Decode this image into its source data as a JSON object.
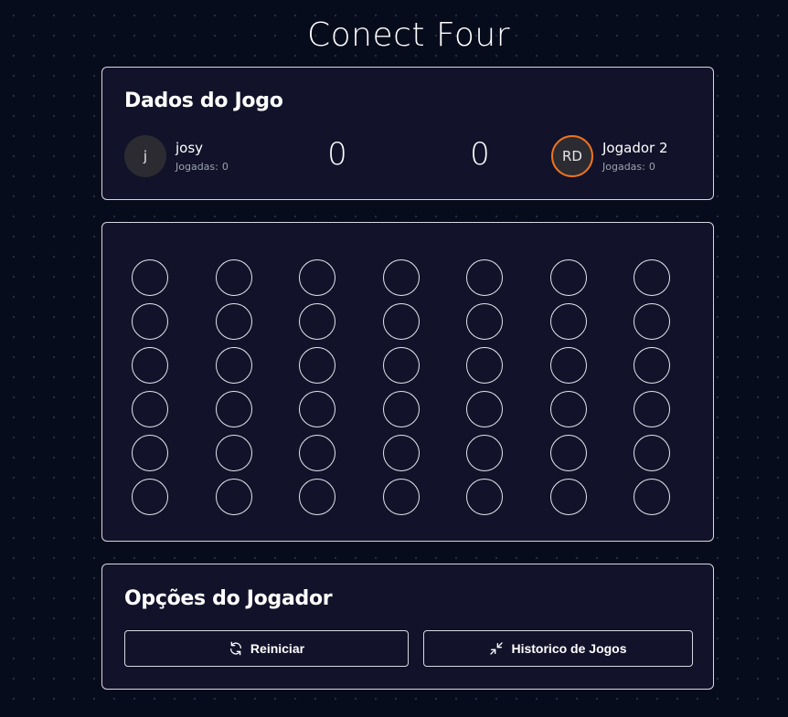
{
  "page": {
    "title": "Conect Four"
  },
  "game_data": {
    "heading": "Dados do Jogo",
    "player1": {
      "avatar_initials": "j",
      "name": "josy",
      "moves_label": "Jogadas:",
      "moves": "0",
      "score": "0"
    },
    "player2": {
      "avatar_initials": "RD",
      "name": "Jogador 2",
      "moves_label": "Jogadas:",
      "moves": "0",
      "score": "0",
      "active_ring_color": "#f0731e"
    }
  },
  "board": {
    "rows": 6,
    "columns": 7,
    "cells": "empty"
  },
  "options": {
    "heading": "Opções do Jogador",
    "restart_label": "Reiniciar",
    "restart_icon": "refresh-icon",
    "history_label": "Historico de Jogos",
    "history_icon": "minimize-arrows-icon"
  }
}
